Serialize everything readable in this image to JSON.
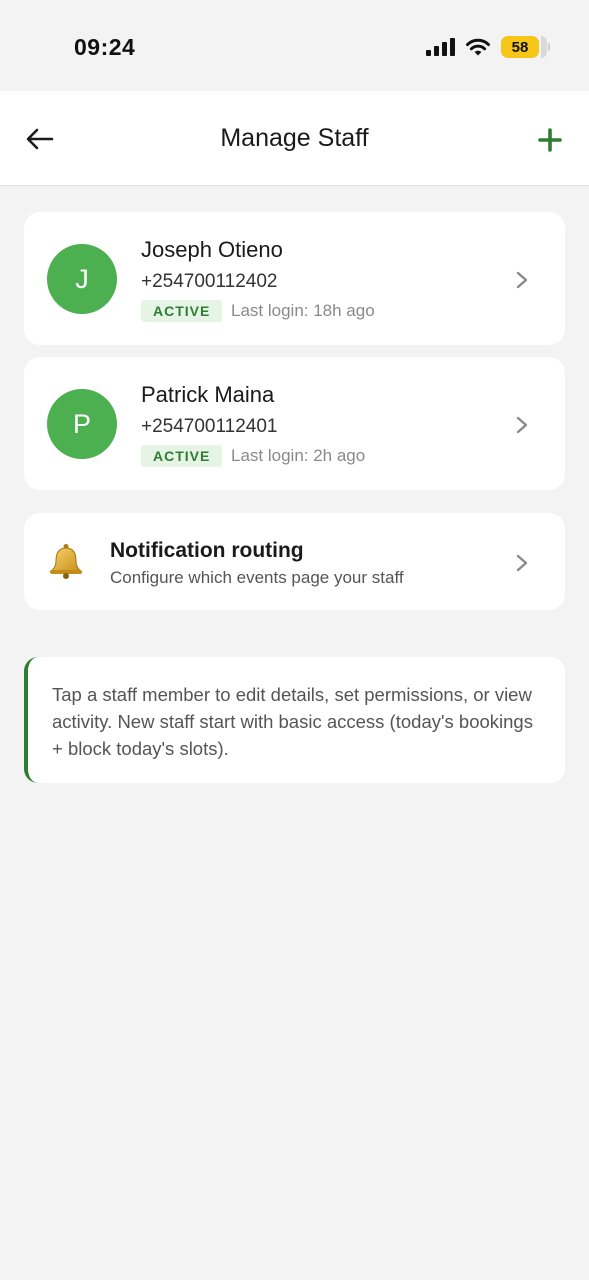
{
  "status_bar": {
    "time": "09:24",
    "battery": "58",
    "icons": [
      "signal-icon",
      "wifi-icon",
      "battery-icon"
    ]
  },
  "header": {
    "title": "Manage Staff",
    "back_icon": "arrow-left-icon",
    "add_icon": "plus-icon"
  },
  "staff": [
    {
      "initial": "J",
      "name": "Joseph Otieno",
      "phone": "+254700112402",
      "status": "ACTIVE",
      "last_login": "Last login: 18h ago"
    },
    {
      "initial": "P",
      "name": "Patrick Maina",
      "phone": "+254700112401",
      "status": "ACTIVE",
      "last_login": "Last login: 2h ago"
    }
  ],
  "notification": {
    "icon": "bell-icon",
    "title": "Notification routing",
    "subtitle": "Configure which events page your staff"
  },
  "info": {
    "text": "Tap a staff member to edit details, set permissions, or view activity. New staff start with basic access (today's bookings + block today's slots)."
  },
  "colors": {
    "accent": "#2e7d32",
    "avatar": "#4caf50",
    "badge_bg": "#e6f4e6",
    "background": "#f3f3f3",
    "battery": "#f5c518"
  }
}
